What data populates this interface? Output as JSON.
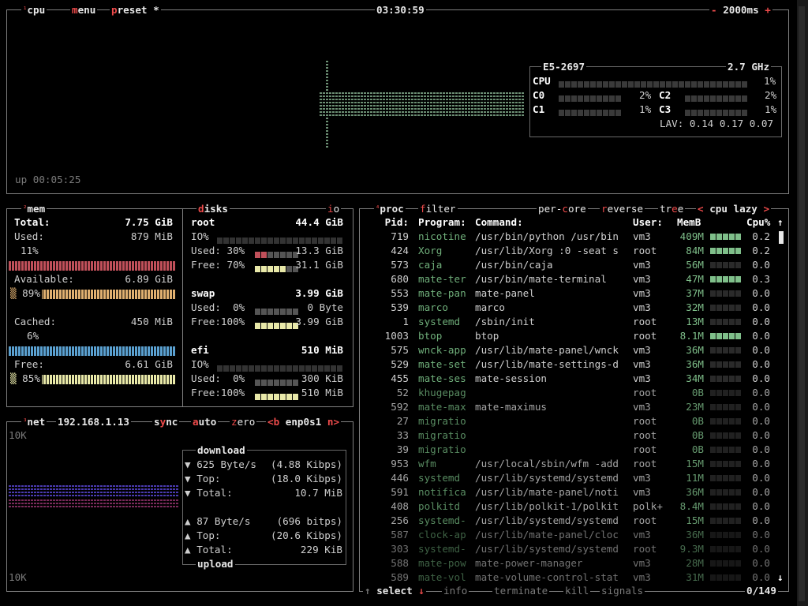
{
  "cpu": {
    "title": "cpu",
    "num": "¹",
    "menu": "menu",
    "preset": "preset *",
    "clock": "03:30:59",
    "minus": "-",
    "interval": "2000ms",
    "plus": "+",
    "uptime": "up 00:05:25",
    "model": "E5-2697",
    "freq": "2.7 GHz",
    "total_label": "CPU",
    "total_pct": "1%",
    "total_level": 0.01,
    "cores": [
      {
        "name": "C0",
        "pct": "2%",
        "level": 0.02
      },
      {
        "name": "C1",
        "pct": "1%",
        "level": 0.01
      },
      {
        "name": "C2",
        "pct": "2%",
        "level": 0.02
      },
      {
        "name": "C3",
        "pct": "1%",
        "level": 0.01
      }
    ],
    "lav": "LAV: 0.14 0.17 0.07"
  },
  "mem": {
    "num": "²",
    "title": "mem",
    "total_label": "Total:",
    "total": "7.75 GiB",
    "used_label": "Used:",
    "used": "879 MiB",
    "used_pct": "11%",
    "avail_label": "Available:",
    "avail": "6.89 GiB",
    "avail_pct": "89%",
    "cached_label": "Cached:",
    "cached": "450 MiB",
    "cached_pct": "6%",
    "free_label": "Free:",
    "free": "6.61 GiB",
    "free_pct": "85%"
  },
  "disks": {
    "title": "disks",
    "io": "io",
    "root": {
      "name": "root",
      "size": "44.4 GiB",
      "io": "IO%",
      "used": "Used: 30%",
      "used_val": "13.3 GiB",
      "used_level": 0.3,
      "free": "Free: 70%",
      "free_val": "31.1 GiB",
      "free_level": 0.7
    },
    "swap": {
      "name": "swap",
      "size": "3.99 GiB",
      "used": "Used:  0%",
      "used_val": "0 Byte",
      "used_level": 0,
      "free": "Free:100%",
      "free_val": "3.99 GiB",
      "free_level": 1
    },
    "efi": {
      "name": "efi",
      "size": "510 MiB",
      "io": "IO%",
      "used": "Used:  0%",
      "used_val": "300 KiB",
      "used_level": 0,
      "free": "Free:100%",
      "free_val": "510 MiB",
      "free_level": 1
    }
  },
  "net": {
    "num": "³",
    "title": "net",
    "ip": "192.168.1.13",
    "sync": "sync",
    "auto": "auto",
    "zero": "zero",
    "prev": "<b",
    "iface": "enp0s1",
    "next": "n>",
    "scale_top": "10K",
    "scale_bottom": "10K",
    "download": "download",
    "upload": "upload",
    "dl_rate": "625 Byte/s",
    "dl_bits": "(4.88 Kibps)",
    "dl_top_label": "Top:",
    "dl_top": "(18.0 Kibps)",
    "dl_total_label": "Total:",
    "dl_total": "10.7 MiB",
    "ul_rate": "87 Byte/s",
    "ul_bits": "(696 bitps)",
    "ul_top_label": "Top:",
    "ul_top": "(20.6 Kibps)",
    "ul_total_label": "Total:",
    "ul_total": "229 KiB"
  },
  "proc": {
    "num": "⁴",
    "title": "proc",
    "filter": "filter",
    "percore": "per-core",
    "reverse": "reverse",
    "tree": "tree",
    "sort_prev": "<",
    "sort": "cpu lazy",
    "sort_next": ">",
    "cols": {
      "pid": "Pid:",
      "program": "Program:",
      "command": "Command:",
      "user": "User:",
      "mem": "MemB",
      "cpu": "Cpu%"
    },
    "rows": [
      {
        "pid": "719",
        "program": "nicotine",
        "command": "/usr/bin/python /usr/bin",
        "user": "vm3",
        "mem": "409M",
        "cpu": "0.2",
        "g": 2
      },
      {
        "pid": "424",
        "program": "Xorg",
        "command": "/usr/lib/Xorg :0 -seat s",
        "user": "root",
        "mem": "84M",
        "cpu": "0.2",
        "g": 2
      },
      {
        "pid": "573",
        "program": "caja",
        "command": "/usr/bin/caja",
        "user": "vm3",
        "mem": "56M",
        "cpu": "0.0",
        "g": 0
      },
      {
        "pid": "680",
        "program": "mate-ter",
        "command": "/usr/bin/mate-terminal",
        "user": "vm3",
        "mem": "47M",
        "cpu": "0.3",
        "g": 1
      },
      {
        "pid": "553",
        "program": "mate-pan",
        "command": "mate-panel",
        "user": "vm3",
        "mem": "37M",
        "cpu": "0.0",
        "g": 0
      },
      {
        "pid": "539",
        "program": "marco",
        "command": "marco",
        "user": "vm3",
        "mem": "32M",
        "cpu": "0.0",
        "g": 0
      },
      {
        "pid": "1",
        "program": "systemd",
        "command": "/sbin/init",
        "user": "root",
        "mem": "13M",
        "cpu": "0.0",
        "g": 0
      },
      {
        "pid": "1003",
        "program": "btop",
        "command": "btop",
        "user": "root",
        "mem": "8.1M",
        "cpu": "0.0",
        "g": 2
      },
      {
        "pid": "575",
        "program": "wnck-app",
        "command": "/usr/lib/mate-panel/wnck",
        "user": "vm3",
        "mem": "36M",
        "cpu": "0.0",
        "g": 0
      },
      {
        "pid": "529",
        "program": "mate-set",
        "command": "/usr/lib/mate-settings-d",
        "user": "vm3",
        "mem": "36M",
        "cpu": "0.0",
        "g": 0
      },
      {
        "pid": "455",
        "program": "mate-ses",
        "command": "mate-session",
        "user": "vm3",
        "mem": "34M",
        "cpu": "0.0",
        "g": 0
      },
      {
        "pid": "52",
        "program": "khugepag",
        "command": "",
        "user": "root",
        "mem": "0B",
        "cpu": "0.0",
        "g": 0
      },
      {
        "pid": "592",
        "program": "mate-max",
        "command": "mate-maximus",
        "user": "vm3",
        "mem": "23M",
        "cpu": "0.0",
        "g": 0
      },
      {
        "pid": "27",
        "program": "migratio",
        "command": "",
        "user": "root",
        "mem": "0B",
        "cpu": "0.0",
        "g": 0
      },
      {
        "pid": "33",
        "program": "migratio",
        "command": "",
        "user": "root",
        "mem": "0B",
        "cpu": "0.0",
        "g": 0
      },
      {
        "pid": "39",
        "program": "migratio",
        "command": "",
        "user": "root",
        "mem": "0B",
        "cpu": "0.0",
        "g": 0
      },
      {
        "pid": "953",
        "program": "wfm",
        "command": "/usr/local/sbin/wfm -add",
        "user": "root",
        "mem": "15M",
        "cpu": "0.0",
        "g": 0
      },
      {
        "pid": "446",
        "program": "systemd",
        "command": "/usr/lib/systemd/systemd",
        "user": "vm3",
        "mem": "11M",
        "cpu": "0.0",
        "g": 0
      },
      {
        "pid": "591",
        "program": "notifica",
        "command": "/usr/lib/mate-panel/noti",
        "user": "vm3",
        "mem": "36M",
        "cpu": "0.0",
        "g": 0
      },
      {
        "pid": "408",
        "program": "polkitd",
        "command": "/usr/lib/polkit-1/polkit",
        "user": "polk+",
        "mem": "8.4M",
        "cpu": "0.0",
        "g": 0
      },
      {
        "pid": "256",
        "program": "systemd-",
        "command": "/usr/lib/systemd/systemd",
        "user": "root",
        "mem": "15M",
        "cpu": "0.0",
        "g": 0
      },
      {
        "pid": "587",
        "program": "clock-ap",
        "command": "/usr/lib/mate-panel/cloc",
        "user": "vm3",
        "mem": "36M",
        "cpu": "0.0",
        "g": 0
      },
      {
        "pid": "303",
        "program": "systemd-",
        "command": "/usr/lib/systemd/systemd",
        "user": "root",
        "mem": "9.3M",
        "cpu": "0.0",
        "g": 0
      },
      {
        "pid": "588",
        "program": "mate-pow",
        "command": "mate-power-manager",
        "user": "vm3",
        "mem": "28M",
        "cpu": "0.0",
        "g": 0
      },
      {
        "pid": "589",
        "program": "mate-vol",
        "command": "mate-volume-control-stat",
        "user": "vm3",
        "mem": "31M",
        "cpu": "0.0",
        "g": 0
      }
    ],
    "scroll_up": "↑",
    "scroll_down": "↓",
    "select": "select",
    "info": "info",
    "terminate": "terminate",
    "kill": "kill",
    "signals": "signals",
    "count": "0/149"
  },
  "colors": {
    "border": "#808080",
    "accent": "#ee4b4b",
    "cpu_graph": "#6b8e73",
    "mem_used": "#c0505a",
    "mem_avail": "#e0b070",
    "mem_cached": "#5aa0d0",
    "mem_free": "#e8e8a8",
    "net_graph": "#4a3aa0"
  }
}
